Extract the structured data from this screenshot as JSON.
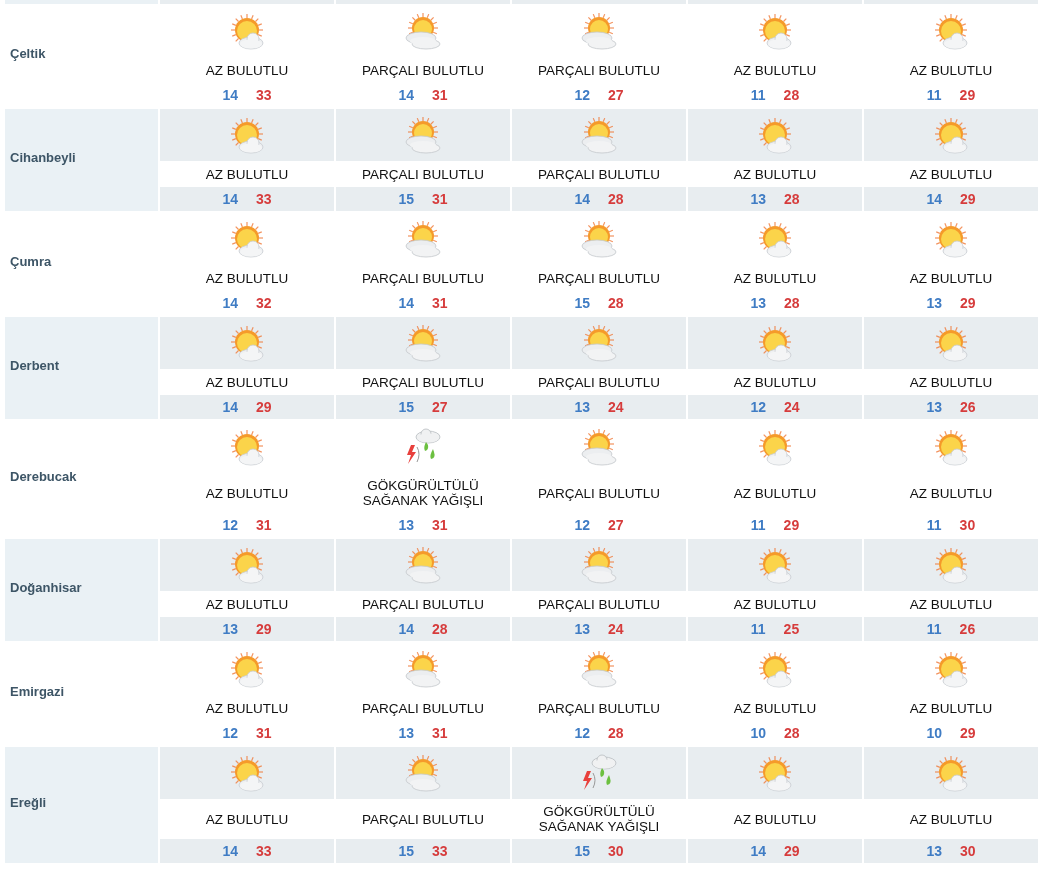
{
  "rows": [
    {
      "name": "Çeltik",
      "days": [
        {
          "kind": "mostly-sunny",
          "condition": "AZ BULUTLU",
          "low": "14",
          "high": "33"
        },
        {
          "kind": "partly-cloudy",
          "condition": "PARÇALI BULUTLU",
          "low": "14",
          "high": "31"
        },
        {
          "kind": "partly-cloudy",
          "condition": "PARÇALI BULUTLU",
          "low": "12",
          "high": "27"
        },
        {
          "kind": "mostly-sunny",
          "condition": "AZ BULUTLU",
          "low": "11",
          "high": "28"
        },
        {
          "kind": "mostly-sunny",
          "condition": "AZ BULUTLU",
          "low": "11",
          "high": "29"
        }
      ]
    },
    {
      "name": "Cihanbeyli",
      "days": [
        {
          "kind": "mostly-sunny",
          "condition": "AZ BULUTLU",
          "low": "14",
          "high": "33"
        },
        {
          "kind": "partly-cloudy",
          "condition": "PARÇALI BULUTLU",
          "low": "15",
          "high": "31"
        },
        {
          "kind": "partly-cloudy",
          "condition": "PARÇALI BULUTLU",
          "low": "14",
          "high": "28"
        },
        {
          "kind": "mostly-sunny",
          "condition": "AZ BULUTLU",
          "low": "13",
          "high": "28"
        },
        {
          "kind": "mostly-sunny",
          "condition": "AZ BULUTLU",
          "low": "14",
          "high": "29"
        }
      ]
    },
    {
      "name": "Çumra",
      "days": [
        {
          "kind": "mostly-sunny",
          "condition": "AZ BULUTLU",
          "low": "14",
          "high": "32"
        },
        {
          "kind": "partly-cloudy",
          "condition": "PARÇALI BULUTLU",
          "low": "14",
          "high": "31"
        },
        {
          "kind": "partly-cloudy",
          "condition": "PARÇALI BULUTLU",
          "low": "15",
          "high": "28"
        },
        {
          "kind": "mostly-sunny",
          "condition": "AZ BULUTLU",
          "low": "13",
          "high": "28"
        },
        {
          "kind": "mostly-sunny",
          "condition": "AZ BULUTLU",
          "low": "13",
          "high": "29"
        }
      ]
    },
    {
      "name": "Derbent",
      "days": [
        {
          "kind": "mostly-sunny",
          "condition": "AZ BULUTLU",
          "low": "14",
          "high": "29"
        },
        {
          "kind": "partly-cloudy",
          "condition": "PARÇALI BULUTLU",
          "low": "15",
          "high": "27"
        },
        {
          "kind": "partly-cloudy",
          "condition": "PARÇALI BULUTLU",
          "low": "13",
          "high": "24"
        },
        {
          "kind": "mostly-sunny",
          "condition": "AZ BULUTLU",
          "low": "12",
          "high": "24"
        },
        {
          "kind": "mostly-sunny",
          "condition": "AZ BULUTLU",
          "low": "13",
          "high": "26"
        }
      ]
    },
    {
      "name": "Derebucak",
      "days": [
        {
          "kind": "mostly-sunny",
          "condition": "AZ BULUTLU",
          "low": "12",
          "high": "31"
        },
        {
          "kind": "thunderstorm",
          "condition": "GÖKGÜRÜLTÜLÜ SAĞANAK YAĞIŞLI",
          "low": "13",
          "high": "31"
        },
        {
          "kind": "partly-cloudy",
          "condition": "PARÇALI BULUTLU",
          "low": "12",
          "high": "27"
        },
        {
          "kind": "mostly-sunny",
          "condition": "AZ BULUTLU",
          "low": "11",
          "high": "29"
        },
        {
          "kind": "mostly-sunny",
          "condition": "AZ BULUTLU",
          "low": "11",
          "high": "30"
        }
      ]
    },
    {
      "name": "Doğanhisar",
      "days": [
        {
          "kind": "mostly-sunny",
          "condition": "AZ BULUTLU",
          "low": "13",
          "high": "29"
        },
        {
          "kind": "partly-cloudy",
          "condition": "PARÇALI BULUTLU",
          "low": "14",
          "high": "28"
        },
        {
          "kind": "partly-cloudy",
          "condition": "PARÇALI BULUTLU",
          "low": "13",
          "high": "24"
        },
        {
          "kind": "mostly-sunny",
          "condition": "AZ BULUTLU",
          "low": "11",
          "high": "25"
        },
        {
          "kind": "mostly-sunny",
          "condition": "AZ BULUTLU",
          "low": "11",
          "high": "26"
        }
      ]
    },
    {
      "name": "Emirgazi",
      "days": [
        {
          "kind": "mostly-sunny",
          "condition": "AZ BULUTLU",
          "low": "12",
          "high": "31"
        },
        {
          "kind": "partly-cloudy",
          "condition": "PARÇALI BULUTLU",
          "low": "13",
          "high": "31"
        },
        {
          "kind": "partly-cloudy",
          "condition": "PARÇALI BULUTLU",
          "low": "12",
          "high": "28"
        },
        {
          "kind": "mostly-sunny",
          "condition": "AZ BULUTLU",
          "low": "10",
          "high": "28"
        },
        {
          "kind": "mostly-sunny",
          "condition": "AZ BULUTLU",
          "low": "10",
          "high": "29"
        }
      ]
    },
    {
      "name": "Ereğli",
      "days": [
        {
          "kind": "mostly-sunny",
          "condition": "AZ BULUTLU",
          "low": "14",
          "high": "33"
        },
        {
          "kind": "partly-cloudy",
          "condition": "PARÇALI BULUTLU",
          "low": "15",
          "high": "33"
        },
        {
          "kind": "thunderstorm",
          "condition": "GÖKGÜRÜLTÜLÜ SAĞANAK YAĞIŞLI",
          "low": "15",
          "high": "30"
        },
        {
          "kind": "mostly-sunny",
          "condition": "AZ BULUTLU",
          "low": "14",
          "high": "29"
        },
        {
          "kind": "mostly-sunny",
          "condition": "AZ BULUTLU",
          "low": "13",
          "high": "30"
        }
      ]
    }
  ]
}
